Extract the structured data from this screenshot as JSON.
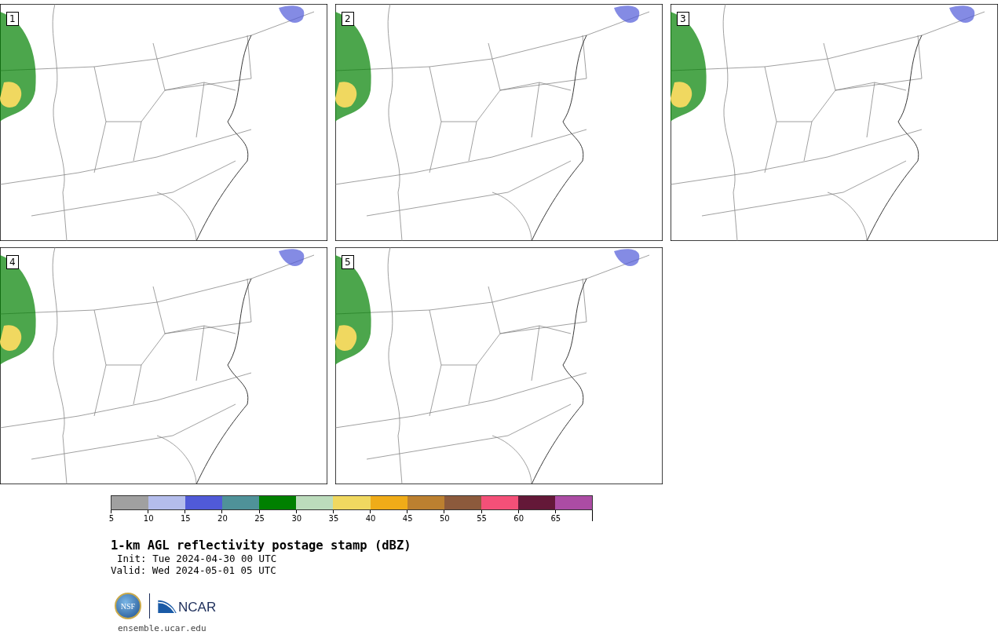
{
  "panels": [
    {
      "label": "1"
    },
    {
      "label": "2"
    },
    {
      "label": "3"
    },
    {
      "label": "4"
    },
    {
      "label": "5"
    }
  ],
  "colorbar": {
    "bins": [
      {
        "color": "#a0a0a0"
      },
      {
        "color": "#b4bdec"
      },
      {
        "color": "#505ad8"
      },
      {
        "color": "#4f9299"
      },
      {
        "color": "#008000"
      },
      {
        "color": "#bcdcbc"
      },
      {
        "color": "#f0d860"
      },
      {
        "color": "#f0ac18"
      },
      {
        "color": "#bc8030"
      },
      {
        "color": "#8c5a3c"
      },
      {
        "color": "#f45078"
      },
      {
        "color": "#641838"
      },
      {
        "color": "#ac4ca4"
      }
    ],
    "ticks": [
      "5",
      "10",
      "15",
      "20",
      "25",
      "30",
      "35",
      "40",
      "45",
      "50",
      "55",
      "60",
      "65"
    ]
  },
  "title": "1-km AGL reflectivity postage stamp (dBZ)",
  "init": "Init: Tue 2024-04-30 00 UTC",
  "valid": "Valid: Wed 2024-05-01 05 UTC",
  "logos": {
    "nsf": "NSF",
    "ncar": "NCAR"
  },
  "url": "ensemble.ucar.edu"
}
